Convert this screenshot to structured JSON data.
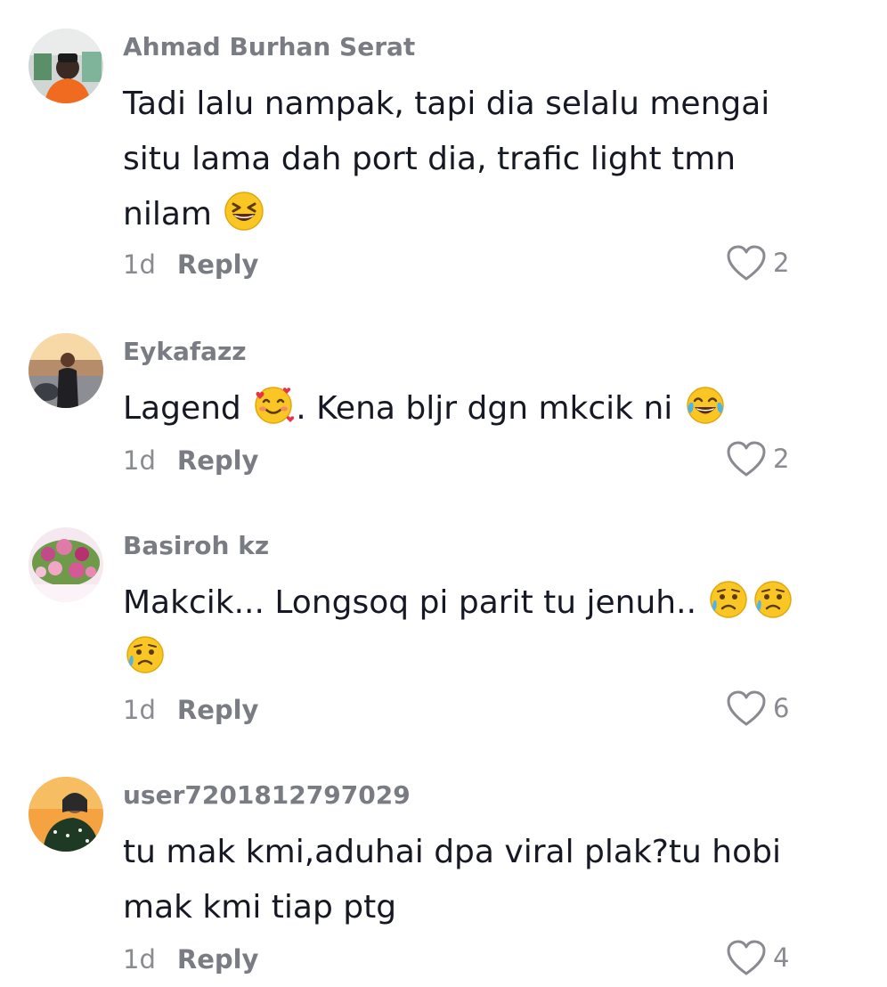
{
  "comments": [
    {
      "username": "Ahmad Burhan Serat",
      "text_parts": [
        "Tadi lalu nampak, tapi dia selalu mengai situ lama dah port dia, trafic light tmn nilam "
      ],
      "emojis": [
        "grinning-squinting-face"
      ],
      "age": "1d",
      "reply_label": "Reply",
      "likes": "2"
    },
    {
      "username": "Eykafazz",
      "text_parts": [
        "Lagend ",
        ". Kena bljr dgn mkcik ni "
      ],
      "emojis": [
        "smiling-face-with-hearts",
        "face-with-tears-of-joy"
      ],
      "age": "1d",
      "reply_label": "Reply",
      "likes": "2"
    },
    {
      "username": "Basiroh kz",
      "text_parts": [
        "Makcik... Longsoq pi parit tu jenuh.. "
      ],
      "emojis": [
        "sad-but-relieved-face",
        "sad-but-relieved-face",
        "sad-but-relieved-face"
      ],
      "age": "1d",
      "reply_label": "Reply",
      "likes": "6"
    },
    {
      "username": "user7201812797029",
      "text_parts": [
        "tu mak kmi,aduhai dpa viral plak?tu hobi mak kmi tiap ptg"
      ],
      "emojis": [],
      "age": "1d",
      "reply_label": "Reply",
      "likes": "4"
    }
  ],
  "colors": {
    "text": "#161823",
    "username": "#7a7c83",
    "meta": "#8a8b91",
    "emoji_yellow": "#f9c623"
  }
}
